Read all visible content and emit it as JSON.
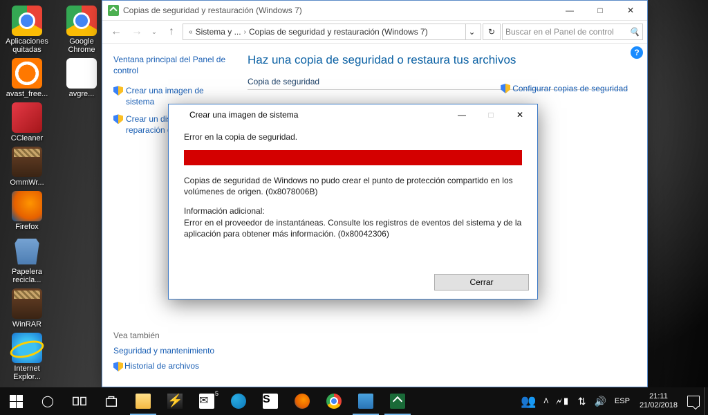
{
  "desktop_icons": [
    {
      "label": "Aplicaciones quitadas",
      "kind": "chrome"
    },
    {
      "label": "avast_free...",
      "kind": "avast"
    },
    {
      "label": "CCleaner",
      "kind": "ccleaner"
    },
    {
      "label": "OmmWr...",
      "kind": "winrar"
    },
    {
      "label": "Firefox",
      "kind": "firefox"
    },
    {
      "label": "Papelera recicla...",
      "kind": "bin"
    },
    {
      "label": "WinRAR",
      "kind": "winrar"
    },
    {
      "label": "Internet Explor...",
      "kind": "ie"
    },
    {
      "label": "Google Chrome",
      "kind": "chrome"
    },
    {
      "label": "avgre...",
      "kind": "file"
    }
  ],
  "cp": {
    "title": "Copias de seguridad y restauración (Windows 7)",
    "breadcrumb": {
      "part1": "Sistema y ...",
      "part2": "Copias de seguridad y restauración (Windows 7)"
    },
    "search_placeholder": "Buscar en el Panel de control",
    "sidebar_title": "Ventana principal del Panel de control",
    "sidebar_links": {
      "create_image": "Crear una imagen de sistema",
      "create_disc": "Crear un disco de reparación del sistema"
    },
    "main_heading": "Haz una copia de seguridad o restaura tus archivos",
    "section": "Copia de seguridad",
    "configure": "Configurar copias de seguridad",
    "see_also": {
      "title": "Vea también",
      "sec": "Seguridad y mantenimiento",
      "hist": "Historial de archivos"
    }
  },
  "dialog": {
    "title": "Crear una imagen de sistema",
    "headline": "Error en la copia de seguridad.",
    "msg1": "Copias de seguridad de Windows no pudo crear el punto de protección compartido en los volúmenes de origen. (0x8078006B)",
    "info_label": "Información adicional:",
    "msg2": "Error en el proveedor de instantáneas. Consulte los registros de eventos del sistema y de la aplicación para obtener más información. (0x80042306)",
    "close": "Cerrar"
  },
  "taskbar": {
    "lang": "ESP",
    "time": "21:11",
    "date": "21/02/2018",
    "mail_badge": "5"
  }
}
